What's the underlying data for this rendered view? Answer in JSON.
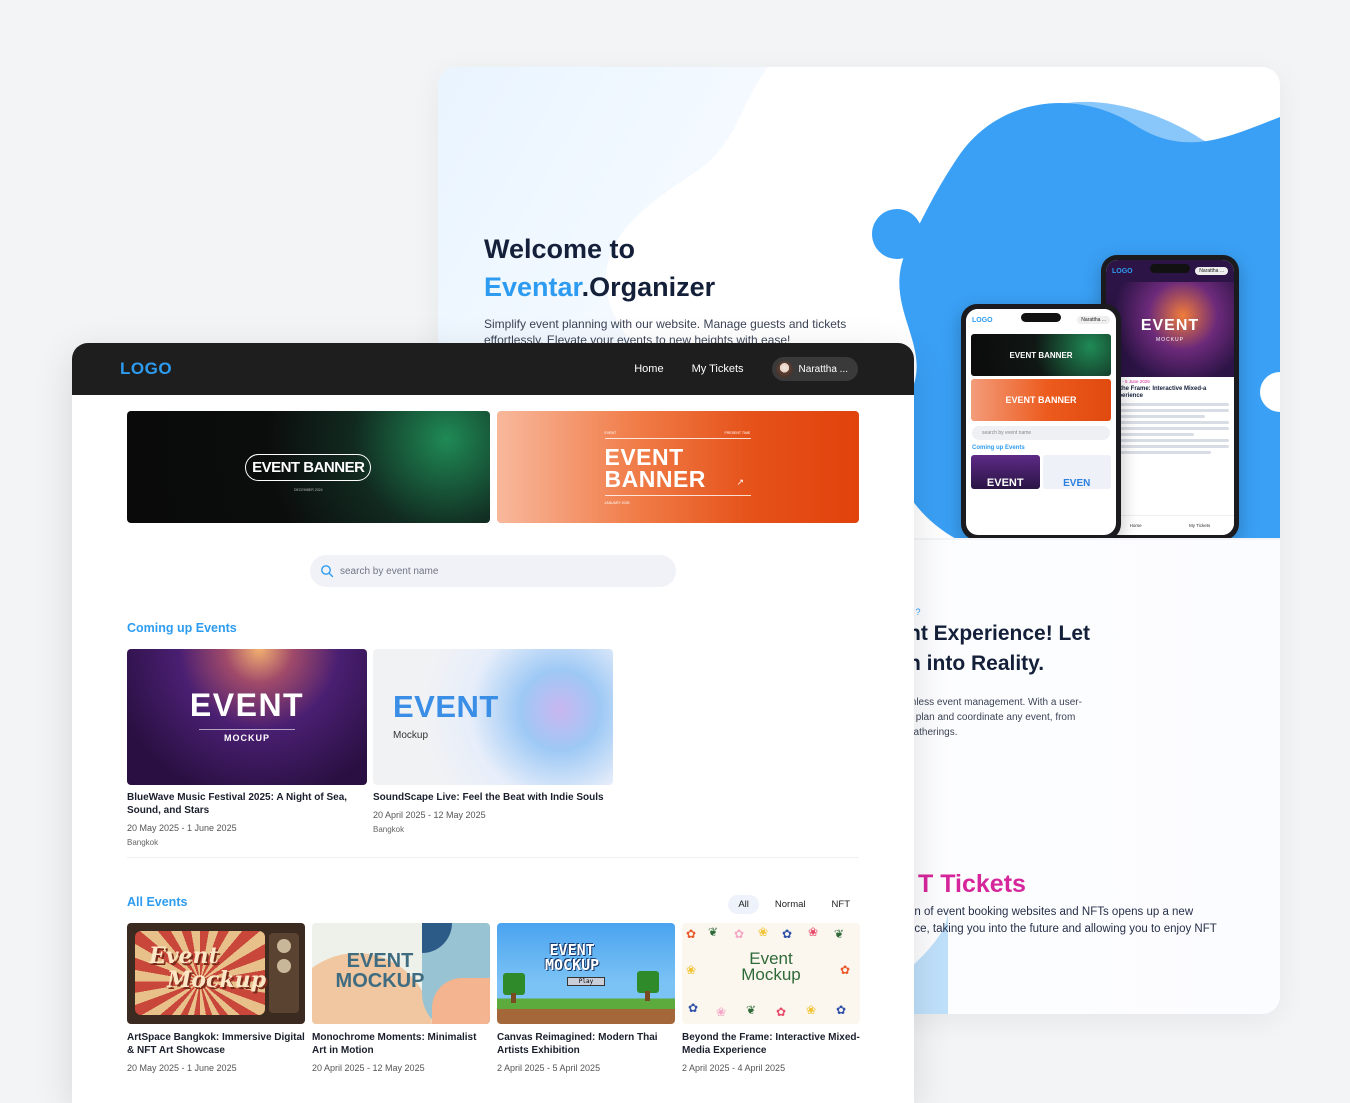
{
  "landing": {
    "welcome_line1": "Welcome to",
    "brand_accent": "Eventar",
    "brand_rest": ".Organizer",
    "subtitle": "Simplify event planning with our website. Manage guests and tickets effortlessly. Elevate your events to new heights with ease!",
    "question": "? ?",
    "headline": "nt Experience! Let\nn into Reality.",
    "paragraph": "mless event management. With a user-\ny plan and coordinate any event, from\ngatherings.",
    "nft_title": "T Tickets",
    "nft_text": "on of event booking websites and NFTs opens up a new\nnce, taking you into the future and allowing you to enjoy NFT"
  },
  "phone_back": {
    "logo": "LOGO",
    "user": "Narattha ...",
    "event_big": "EVENT",
    "event_small": "MOCKUP",
    "date": "2025 - 5 June 2025",
    "title": "nd the Frame: Interactive Mixed-a Experience",
    "tab_home": "Home",
    "tab_tickets": "My Tickets"
  },
  "phone_front": {
    "logo": "LOGO",
    "user": "Narattha ...",
    "banner1": "EVENT BANNER",
    "banner2": "EVENT BANNER",
    "search_placeholder": "search by event name",
    "section": "Coming up Events",
    "card1": "EVENT",
    "card2": "EVEN"
  },
  "app": {
    "logo": "LOGO",
    "nav": {
      "home": "Home",
      "tickets": "My Tickets",
      "user": "Narattha ..."
    },
    "banners": {
      "dark_label": "EVENT BANNER",
      "dark_sub": "DECEMBER 2024",
      "orange_line1": "EVENT",
      "orange_line2": "BANNER",
      "orange_tiny_left": "EVENT",
      "orange_tiny_right": "PRESENT TIME",
      "orange_tiny_bottom": "JANUARY 2025"
    },
    "search": {
      "placeholder": "search by event name"
    },
    "upcoming_title": "Coming up Events",
    "upcoming": [
      {
        "img_big": "EVENT",
        "img_small": "MOCKUP",
        "title": "BlueWave Music Festival 2025: A Night of Sea, Sound, and Stars",
        "date": "20 May 2025 - 1 June 2025",
        "location": "Bangkok"
      },
      {
        "img_big": "EVENT",
        "img_small": "Mockup",
        "title": "SoundScape Live: Feel the Beat with Indie Souls",
        "date": "20 April 2025 - 12 May 2025",
        "location": "Bangkok"
      }
    ],
    "all_title": "All Events",
    "filters": [
      "All",
      "Normal",
      "NFT"
    ],
    "all_events": [
      {
        "img_text1": "Event",
        "img_text2": "Mockup",
        "title": "ArtSpace Bangkok: Immersive Digital & NFT Art Showcase",
        "date": "20 May 2025 - 1 June 2025"
      },
      {
        "img_text1": "EVENT",
        "img_text2": "MOCKUP",
        "title": "Monochrome Moments: Minimalist Art in Motion",
        "date": "20 April 2025 - 12 May 2025"
      },
      {
        "img_text1": "EVENT",
        "img_text2": "MOCKUP",
        "img_text3": "Play",
        "title": "Canvas Reimagined: Modern Thai Artists Exhibition",
        "date": "2 April 2025 - 5 April 2025"
      },
      {
        "img_text1": "Event",
        "img_text2": "Mockup",
        "title": "Beyond the Frame: Interactive Mixed-Media Experience",
        "date": "2 April 2025 - 4 April 2025"
      }
    ]
  },
  "colors": {
    "accent": "#2d9cf0",
    "navbar": "#1e1e1e",
    "nft_pink": "#d6269b",
    "text_dark": "#14203a"
  }
}
